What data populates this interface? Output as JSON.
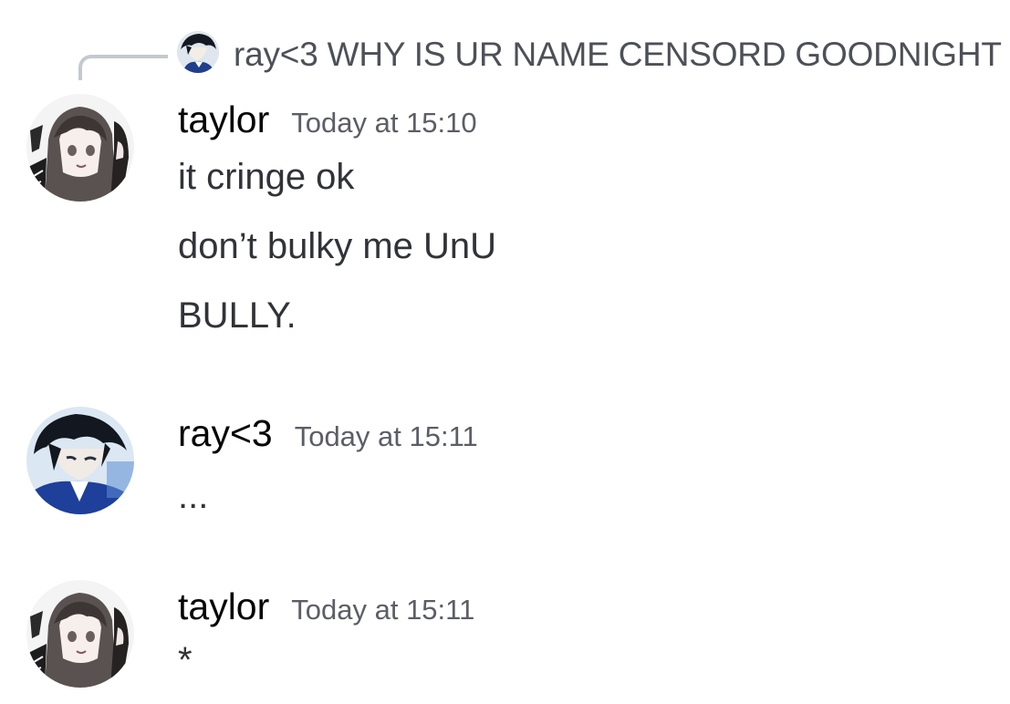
{
  "reply": {
    "author": "ray<3",
    "text": "ray<3 WHY IS UR NAME CENSORD GOODNIGHT",
    "avatar_icon": "dark-haired-boy-avatar"
  },
  "messages": [
    {
      "author": "taylor",
      "timestamp": "Today at 15:10",
      "avatar_icon": "long-haired-girl-avatar",
      "lines": [
        "it cringe ok",
        "don’t bulky me UnU",
        "BULLY."
      ]
    },
    {
      "author": "ray<3",
      "timestamp": "Today at 15:11",
      "avatar_icon": "dark-haired-boy-avatar",
      "lines": [
        "..."
      ]
    },
    {
      "author": "taylor",
      "timestamp": "Today at 15:11",
      "avatar_icon": "long-haired-girl-avatar",
      "lines": [
        "*"
      ]
    }
  ],
  "colors": {
    "background": "#ffffff",
    "author": "#060607",
    "text": "#313338",
    "timestamp": "#5c5e66",
    "reply_spine": "#c4c9ce"
  }
}
